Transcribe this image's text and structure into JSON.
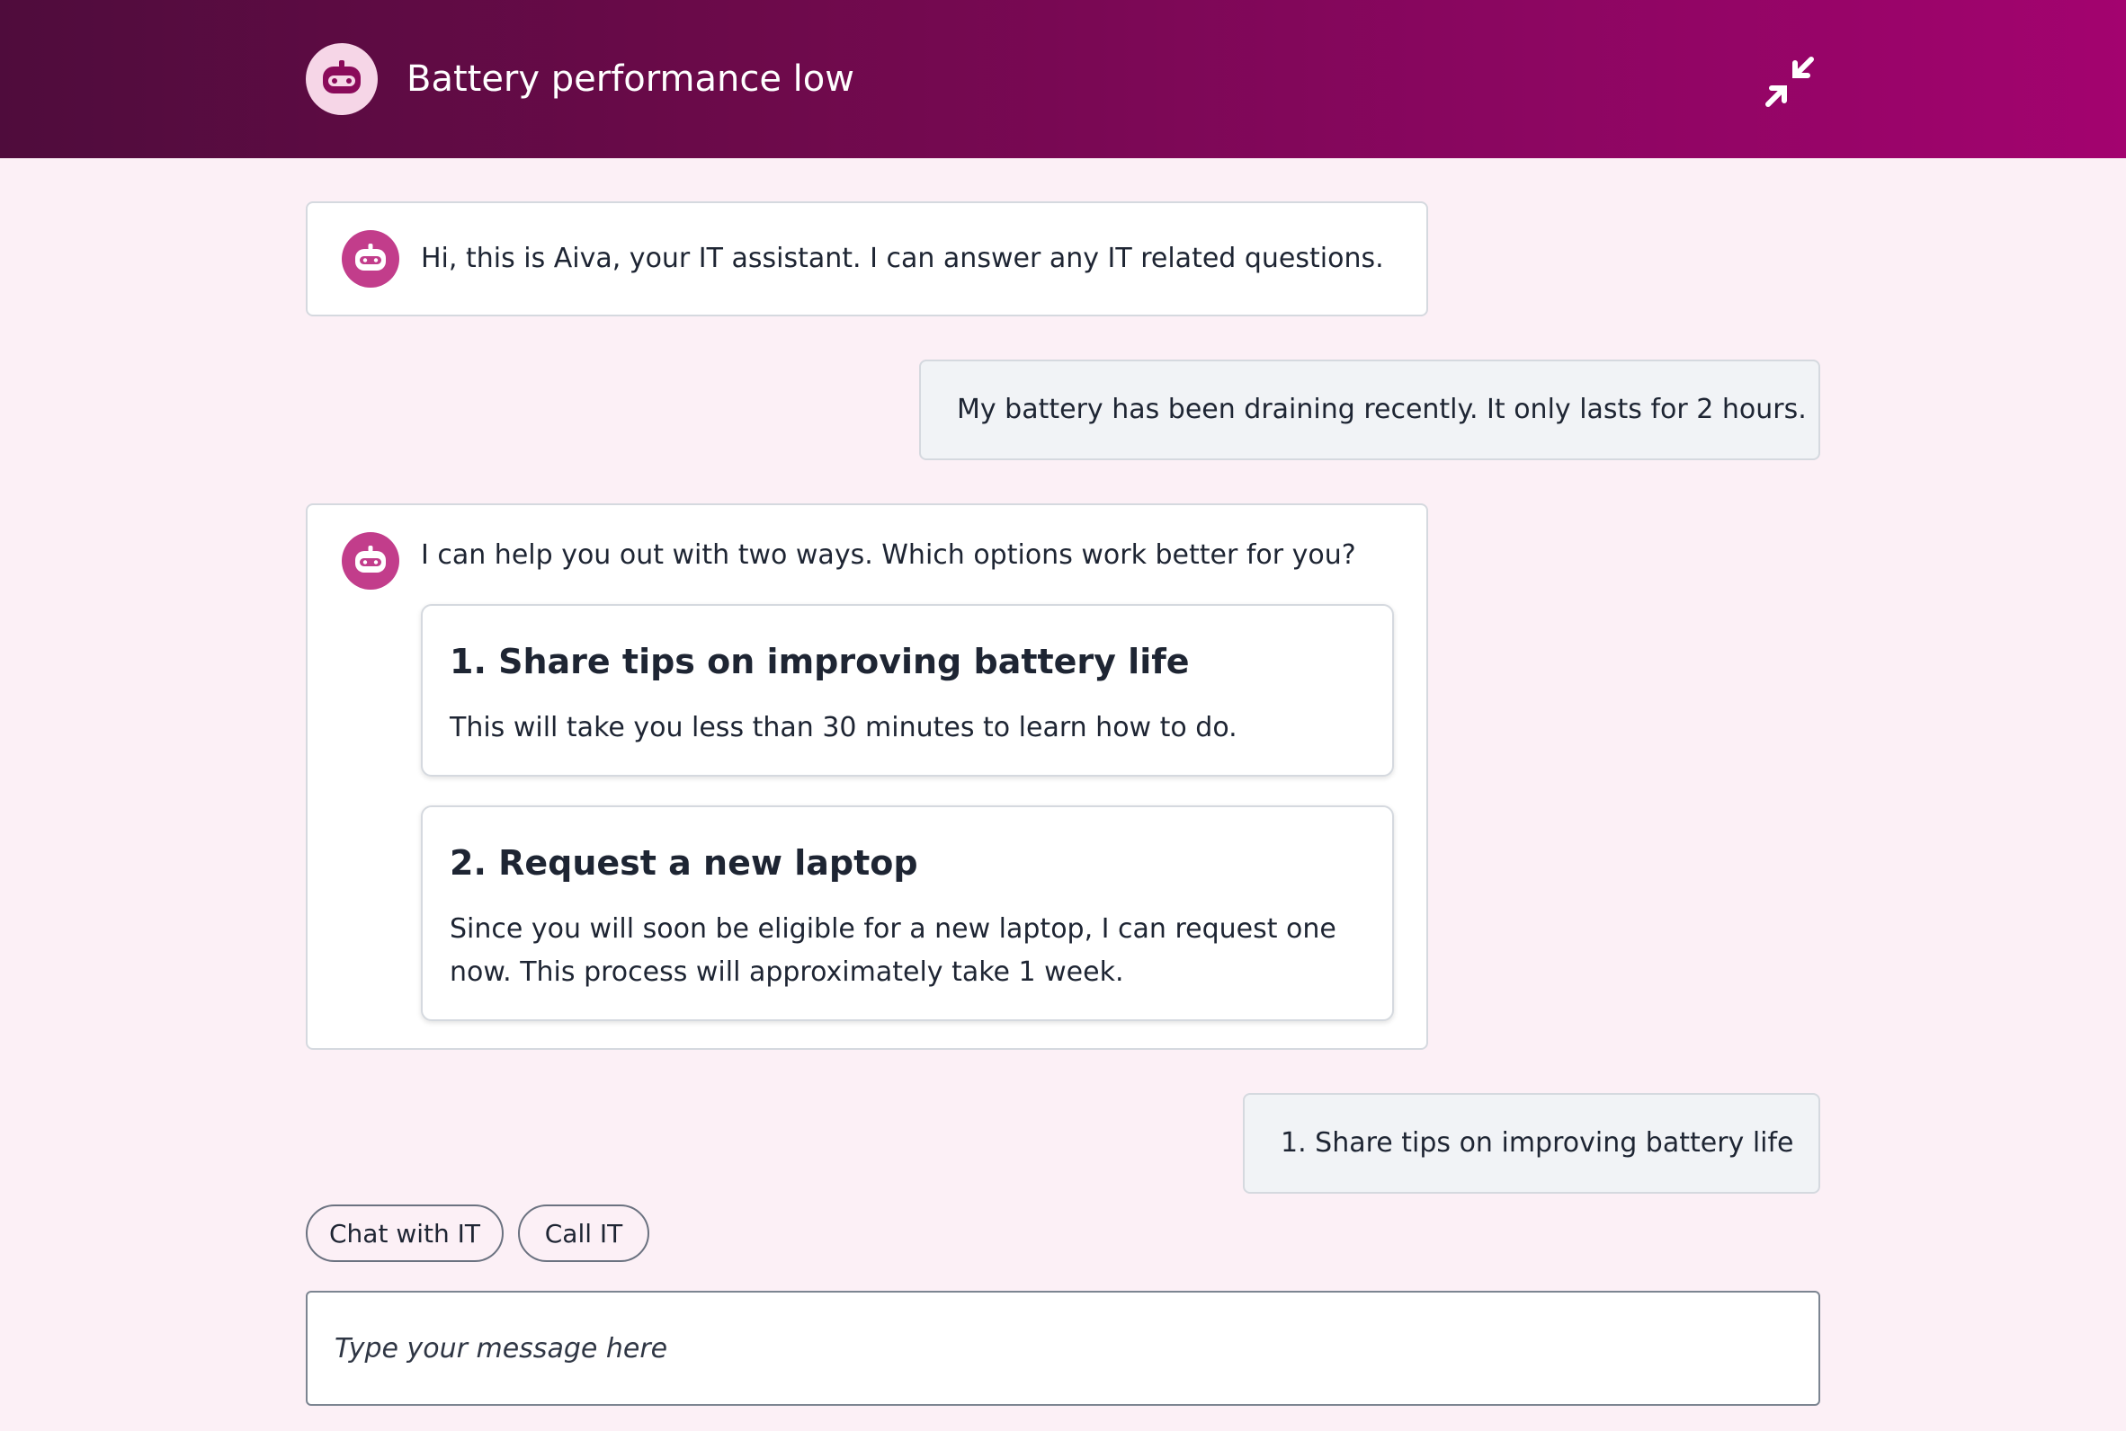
{
  "header": {
    "title": "Battery performance low",
    "avatar_icon": "robot-icon",
    "minimize_icon": "minimize-icon",
    "gradient_start": "#4f0c3c",
    "gradient_end": "#a3036f"
  },
  "conversation": {
    "messages": [
      {
        "sender": "bot",
        "text": "Hi, this is Aiva, your IT assistant. I can answer any IT related questions."
      },
      {
        "sender": "user",
        "text": "My battery has been draining recently. It only lasts for 2 hours."
      },
      {
        "sender": "bot",
        "text": "I can help you out with two ways. Which options work better for you?",
        "options": [
          {
            "title": "1. Share tips on improving battery life",
            "description_lines": [
              "This will take you less than 30 minutes to learn how to do."
            ]
          },
          {
            "title": "2. Request a new laptop",
            "description_lines": [
              "Since you will soon be eligible for a new laptop, I can request one",
              "now. This process will approximately take 1 week."
            ]
          }
        ]
      },
      {
        "sender": "user",
        "text": "1. Share tips on improving battery life"
      }
    ]
  },
  "quick_actions": [
    {
      "label": "Chat with IT"
    },
    {
      "label": "Call IT"
    }
  ],
  "composer": {
    "placeholder": "Type your message here",
    "value": ""
  },
  "colors": {
    "background": "#fcf0f6",
    "bot_avatar": "#c23d8b",
    "user_bubble": "#f1f3f6"
  }
}
